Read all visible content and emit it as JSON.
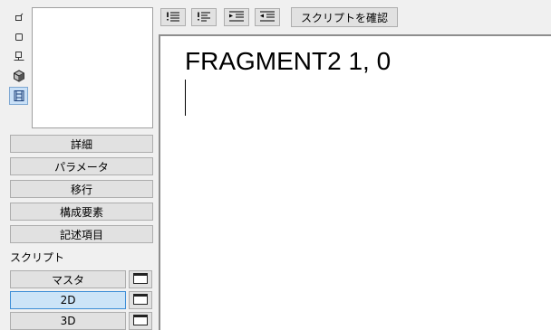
{
  "view_icons": [
    {
      "icon": "select-2d-icon",
      "active": false
    },
    {
      "icon": "square-outline-icon",
      "active": false
    },
    {
      "icon": "stamp-icon",
      "active": false
    },
    {
      "icon": "3d-cube-icon",
      "active": false
    },
    {
      "icon": "film-strip-icon",
      "active": true
    }
  ],
  "left_panel": {
    "buttons": {
      "details": "詳細",
      "parameters": "パラメータ",
      "migration": "移行",
      "components": "構成要素",
      "descriptors": "記述項目"
    },
    "script_label": "スクリプト",
    "script_buttons": {
      "master": "マスタ",
      "two_d": "2D",
      "three_d": "3D"
    },
    "selected_script": "2D"
  },
  "toolbar": {
    "check_script_label": "スクリプトを確認"
  },
  "editor": {
    "code_line": "FRAGMENT2 1, 0"
  }
}
